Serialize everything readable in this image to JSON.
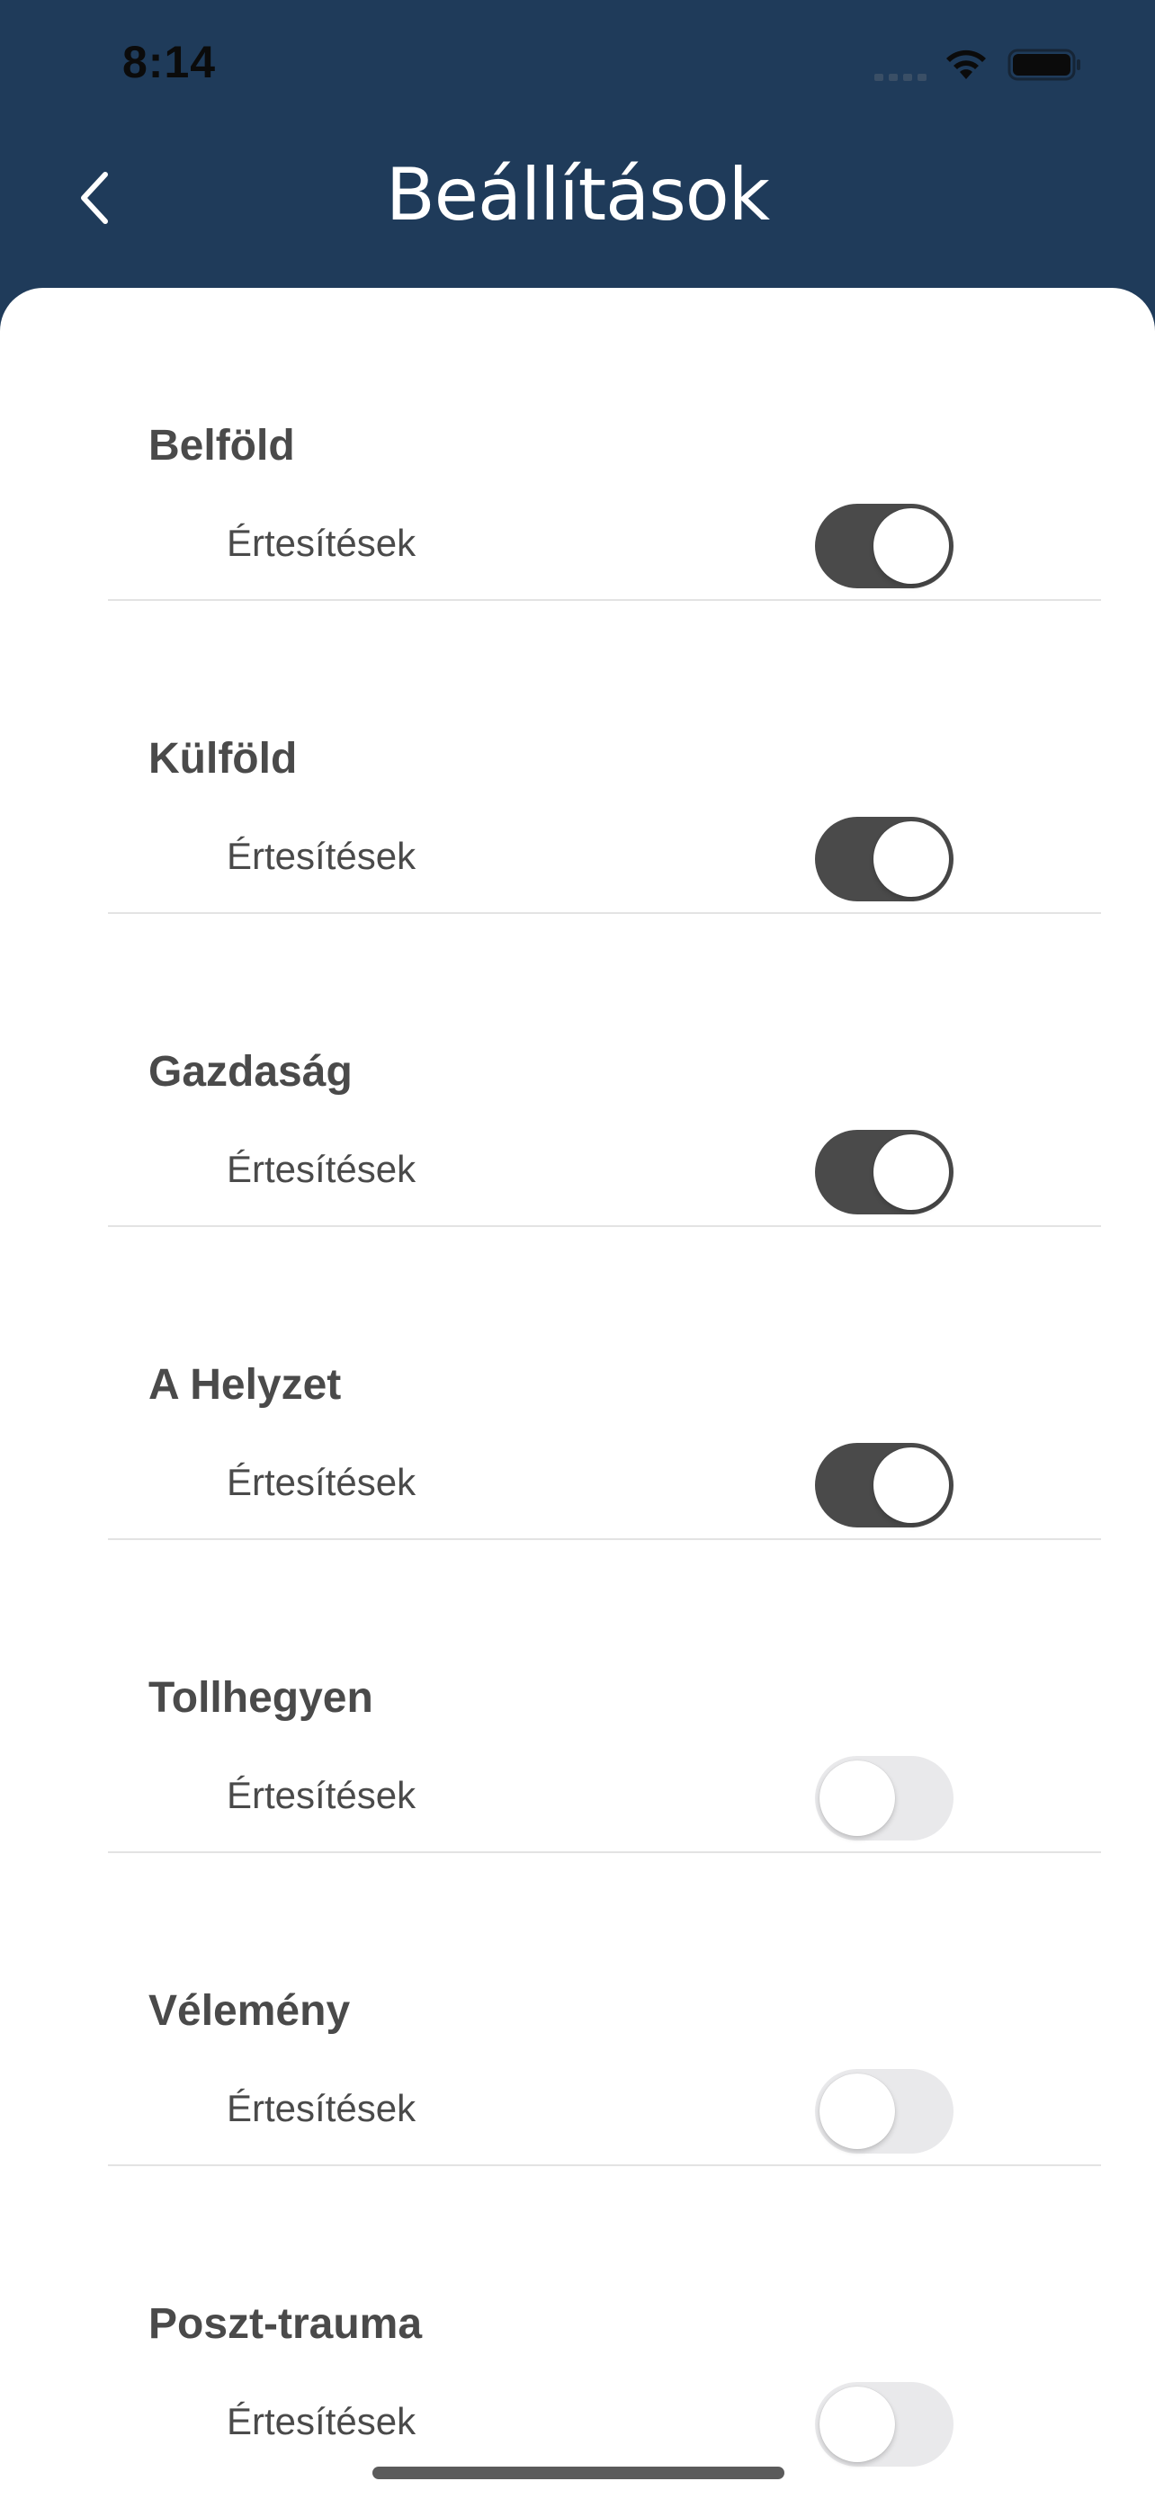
{
  "status_bar": {
    "time": "8:14",
    "icons": [
      "signal-icon",
      "wifi-icon",
      "battery-icon"
    ]
  },
  "nav": {
    "title": "Beállítások",
    "back_icon": "chevron-left-icon"
  },
  "colors": {
    "header_background": "#1f3b5a",
    "toggle_on": "#4a4a4a",
    "toggle_off": "#e9e9eb",
    "text": "#4a4a4a"
  },
  "sections": [
    {
      "title": "Belföld",
      "row_label": "Értesítések",
      "enabled": true
    },
    {
      "title": "Külföld",
      "row_label": "Értesítések",
      "enabled": true
    },
    {
      "title": "Gazdaság",
      "row_label": "Értesítések",
      "enabled": true
    },
    {
      "title": "A Helyzet",
      "row_label": "Értesítések",
      "enabled": true
    },
    {
      "title": "Tollhegyen",
      "row_label": "Értesítések",
      "enabled": false
    },
    {
      "title": "Vélemény",
      "row_label": "Értesítések",
      "enabled": false
    },
    {
      "title": "Poszt-trauma",
      "row_label": "Értesítések",
      "enabled": false
    }
  ]
}
